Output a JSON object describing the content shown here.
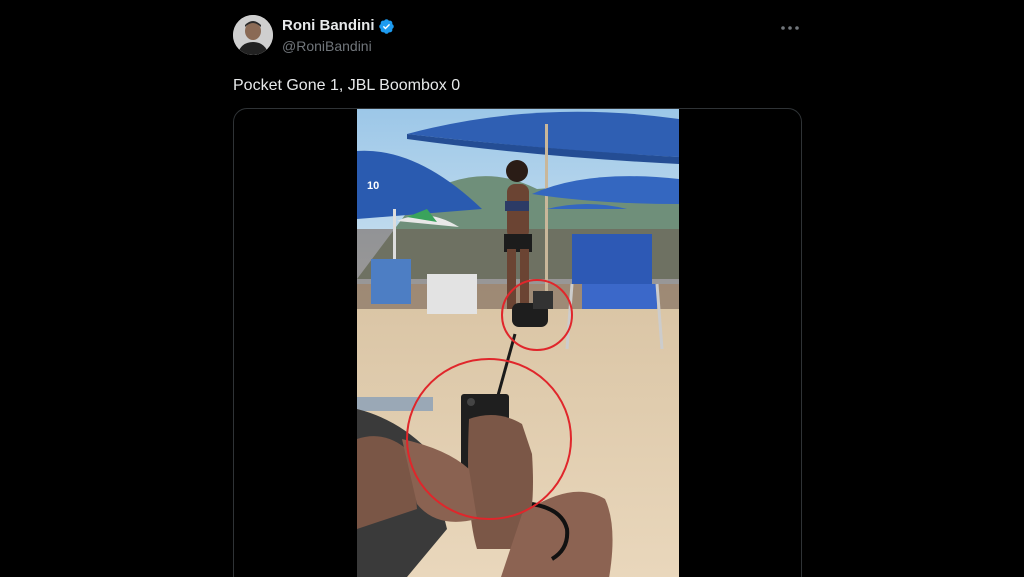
{
  "post": {
    "display_name": "Roni Bandini",
    "handle": "@RoniBandini",
    "text": "Pocket Gone 1, JBL Boombox 0",
    "verified": true
  },
  "icons": {
    "verified": "verified-badge-icon",
    "more": "more-horizontal-icon"
  },
  "media": {
    "umbrella_number": "10"
  },
  "colors": {
    "background": "#000000",
    "text_primary": "#e7e9ea",
    "text_secondary": "#71767b",
    "verified_blue": "#1d9bf0",
    "annotation_red": "#e0262b",
    "border": "#2f3336"
  }
}
